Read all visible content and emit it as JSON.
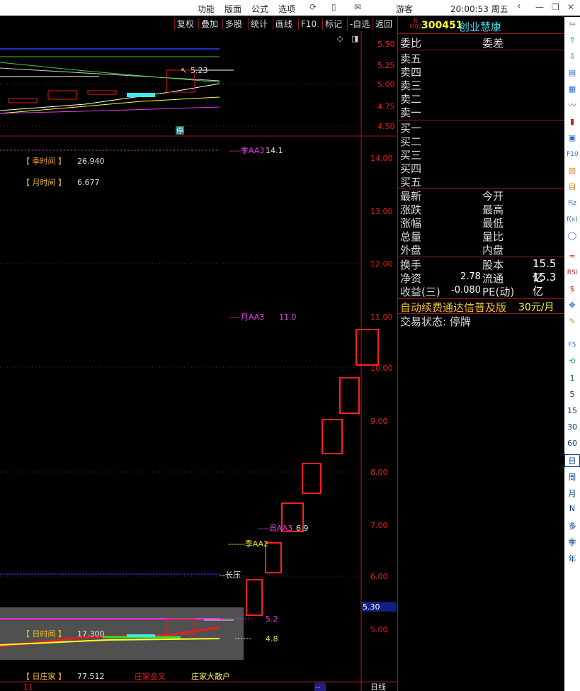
{
  "menu": {
    "items": [
      "功能",
      "版面",
      "公式",
      "选项"
    ],
    "user": "游客",
    "time": "20:00:53 周五"
  },
  "toolbar": {
    "buttons": [
      "复权",
      "叠加",
      "多股",
      "统计",
      "画线",
      "F10",
      "标记",
      "-自选",
      "返回"
    ]
  },
  "chart": {
    "upper": {
      "price_ticks": [
        "5.50",
        "5.25",
        "5.00",
        "4.75",
        "4.50"
      ],
      "last": "5.23",
      "halt_badge": "停"
    },
    "lower": {
      "price_ticks": [
        "14.00",
        "13.00",
        "12.00",
        "11.00",
        "10.00",
        "9.00",
        "8.00",
        "7.00",
        "6.00",
        "5.00"
      ],
      "current_price": "5.30"
    },
    "labels": {
      "season_time": "【 季时间 】",
      "season_time_val": "26.940",
      "month_time": "【 月时间 】",
      "month_time_val": "6.677",
      "season_aa3": "----季AA3",
      "season_aa3_val": "14.1",
      "month_aa3": "----月AA3",
      "month_aa3_val": "11.0",
      "week_aa3": "----周AA3",
      "week_aa3_val": "6.9",
      "season_aa2": "------季AA2",
      "long_press": "--长压",
      "day_time": "【 日时间 】",
      "day_time_val": "17.300",
      "v52": "5.2",
      "v48": "4.8",
      "day_dealer": "【 日庄家 】",
      "day_dealer_val": "77.512",
      "dealer_cross": "庄家金叉",
      "dealer_retail": "庄家大散户",
      "x_label": "11",
      "period": "日线",
      "scroll": "--"
    }
  },
  "quote": {
    "code": "300451",
    "name": "创业慧康",
    "badge_top": "R",
    "badge_bottom": "I000",
    "ratio": "委比",
    "diff": "委差",
    "asks": [
      "卖五",
      "卖四",
      "卖三",
      "卖二",
      "卖一"
    ],
    "bids": [
      "买一",
      "买二",
      "买三",
      "买四",
      "买五"
    ],
    "stats_left": [
      "最新",
      "涨跌",
      "涨幅",
      "总量",
      "外盘"
    ],
    "stats_right": [
      "今开",
      "最高",
      "最低",
      "量比",
      "内盘"
    ],
    "turnover": "换手",
    "equity": "股本",
    "equity_val": "15.5亿",
    "nav": "净资",
    "nav_val": "2.78",
    "float": "流通",
    "float_val": "15.3亿",
    "eps": "收益(三)",
    "eps_val": "-0.080",
    "pe": "PE(动)",
    "promo": "自动续费通达信普及版",
    "promo_price": "30元/月",
    "status": "交易状态: 停牌"
  },
  "periods": [
    "1",
    "5",
    "15",
    "30",
    "60",
    "日",
    "周",
    "月",
    "N",
    "多",
    "季",
    "年"
  ],
  "colors": {
    "accent_red": "#e02020",
    "grid_red": "#a01818",
    "yellow": "#f0e020",
    "magenta": "#e040e0",
    "cyan": "#40e0f0"
  }
}
